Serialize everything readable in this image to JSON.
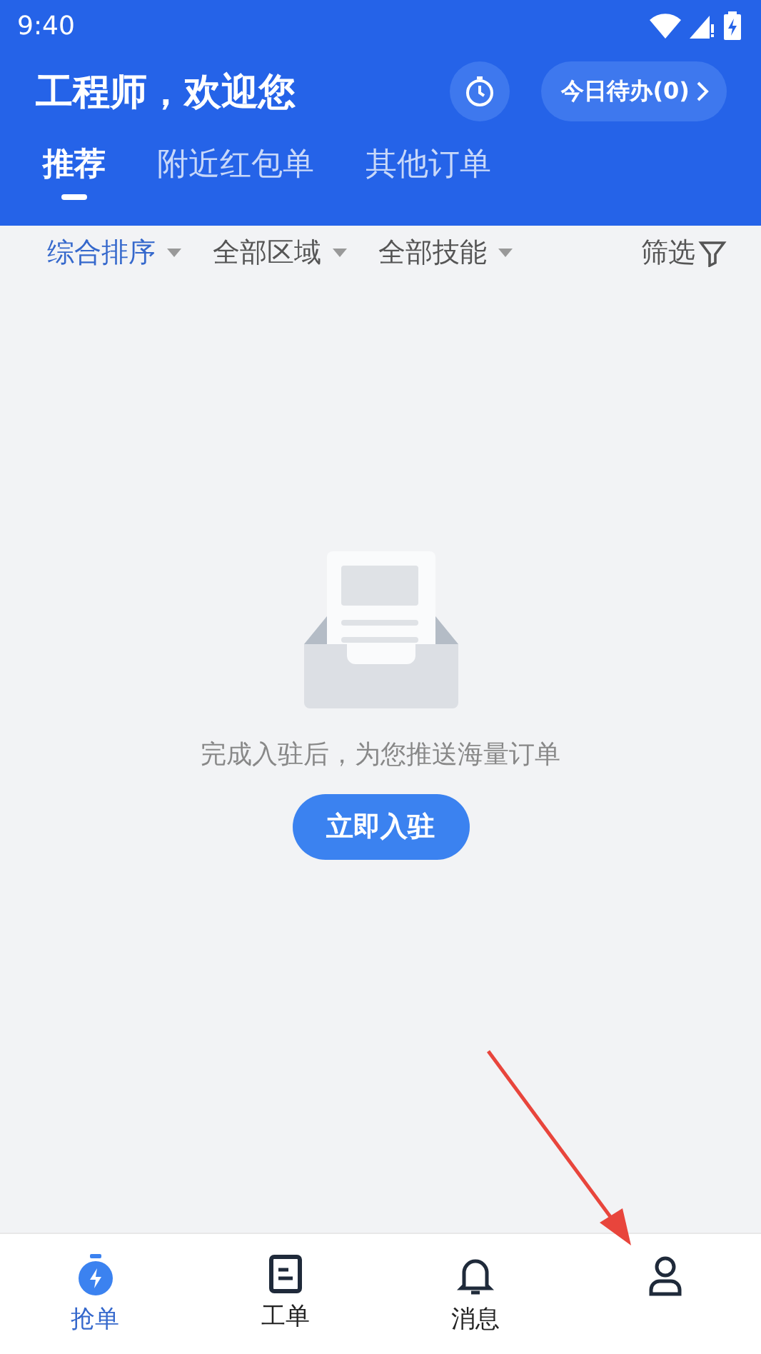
{
  "status_bar": {
    "time": "9:40"
  },
  "header": {
    "title": "工程师，欢迎您",
    "todo_button": "今日待办(0)"
  },
  "tabs": [
    {
      "label": "推荐",
      "selected": true
    },
    {
      "label": "附近红包单",
      "selected": false
    },
    {
      "label": "其他订单",
      "selected": false
    }
  ],
  "filters": [
    {
      "label": "综合排序",
      "selected": true
    },
    {
      "label": "全部区域",
      "selected": false
    },
    {
      "label": "全部技能",
      "selected": false
    }
  ],
  "filter_button": "筛选",
  "empty_state": {
    "message": "完成入驻后，为您推送海量订单",
    "button": "立即入驻"
  },
  "bottom_nav": [
    {
      "kind": "grab",
      "label": "抢单",
      "selected": true
    },
    {
      "kind": "orders",
      "label": "工单",
      "selected": false
    },
    {
      "kind": "messages",
      "label": "消息",
      "selected": false
    },
    {
      "kind": "profile",
      "selected": false
    }
  ]
}
